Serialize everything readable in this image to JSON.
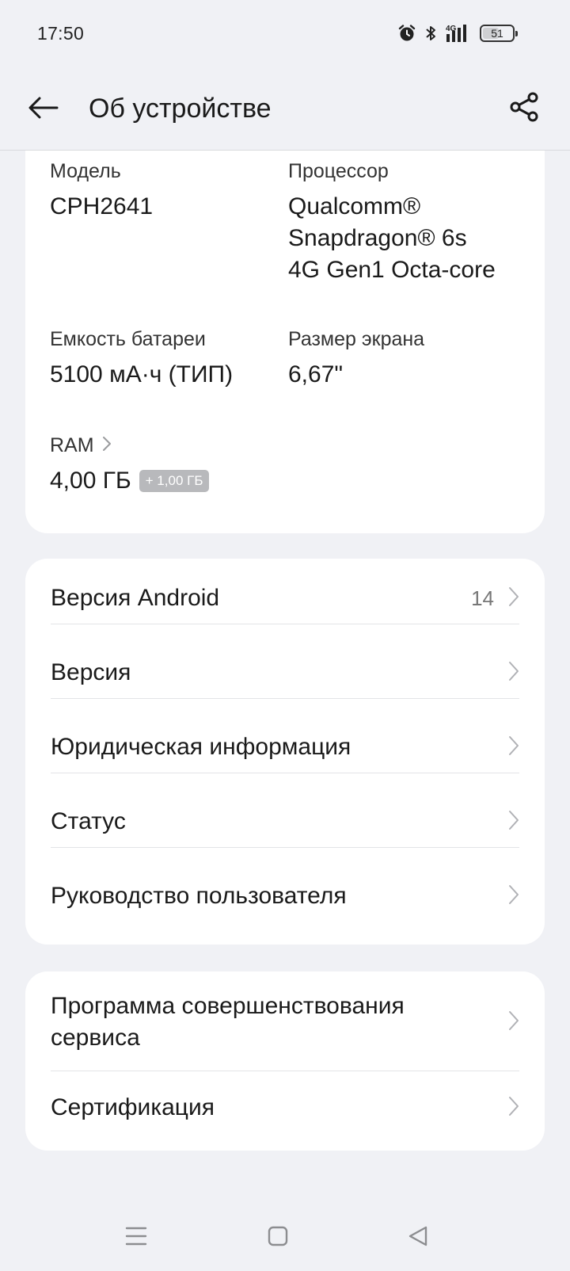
{
  "status_bar": {
    "time": "17:50",
    "network": "4G",
    "battery_level": "51",
    "icons": [
      "alarm-icon",
      "bluetooth-icon",
      "signal-icon",
      "battery-icon"
    ]
  },
  "app_bar": {
    "title": "Об устройстве",
    "back_icon": "arrow-left-icon",
    "share_icon": "share-icon"
  },
  "specs": {
    "model": {
      "label": "Модель",
      "value": "CPH2641"
    },
    "processor": {
      "label": "Процессор",
      "value_lines": [
        "Qualcomm®",
        "Snapdragon® 6s",
        "4G Gen1 Octa-core"
      ]
    },
    "battery": {
      "label": "Емкость батареи",
      "value": "5100 мА·ч (ТИП)"
    },
    "screen": {
      "label": "Размер экрана",
      "value": "6,67\""
    },
    "ram": {
      "label": "RAM",
      "value": "4,00 ГБ",
      "extra": "+ 1,00 ГБ"
    }
  },
  "list1": [
    {
      "label": "Версия Android",
      "value": "14"
    },
    {
      "label": "Версия",
      "value": ""
    },
    {
      "label": "Юридическая информация",
      "value": ""
    },
    {
      "label": "Статус",
      "value": ""
    },
    {
      "label": "Руководство пользователя",
      "value": ""
    }
  ],
  "list2": [
    {
      "label_lines": [
        "Программа совершенствования",
        "сервиса"
      ]
    },
    {
      "label": "Сертификация"
    }
  ],
  "nav_bar": {
    "icons": [
      "menu-icon",
      "home-icon",
      "back-triangle-icon"
    ]
  },
  "colors": {
    "background": "#f0f1f5",
    "card": "#ffffff",
    "badge": "#b8b9bc",
    "chevron": "#b0b1b5"
  }
}
